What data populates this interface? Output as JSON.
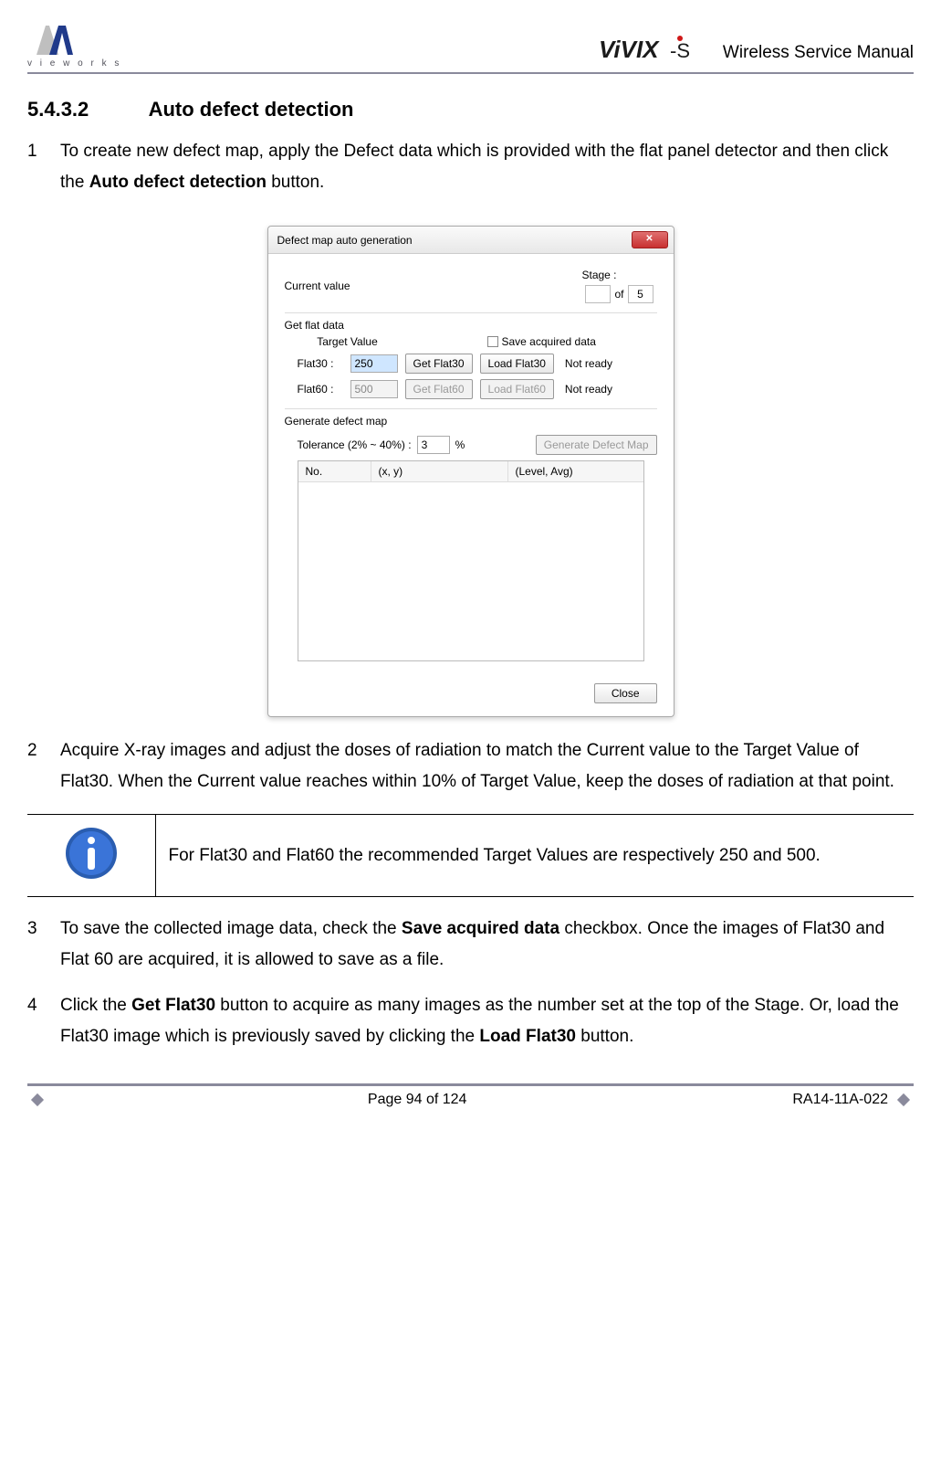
{
  "header": {
    "left_logo_text": "vieworks",
    "right_logo_text": "ViVIX-S",
    "right_label": "Wireless Service Manual"
  },
  "section": {
    "number": "5.4.3.2",
    "title": "Auto defect detection"
  },
  "steps": {
    "s1": {
      "num": "1",
      "text_a": "To create new defect map, apply the Defect data which is provided with the flat panel detector and then click the ",
      "bold_a": "Auto defect detection",
      "text_b": " button."
    },
    "s2": {
      "num": "2",
      "text": "Acquire X-ray images and adjust the doses of radiation to match the Current value to the Target Value of Flat30. When the Current value reaches within 10% of Target Value, keep the doses of radiation at that point."
    },
    "s3": {
      "num": "3",
      "text_a": "To save the collected image data, check the ",
      "bold_a": "Save acquired data",
      "text_b": " checkbox. Once the images of Flat30 and Flat 60 are acquired, it is allowed to save as a file."
    },
    "s4": {
      "num": "4",
      "text_a": "Click the ",
      "bold_a": "Get Flat30",
      "text_b": " button to acquire as many images as the number set at the top of the Stage. Or, load the Flat30 image which is previously saved by clicking the ",
      "bold_b": "Load Flat30",
      "text_c": " button."
    }
  },
  "dialog": {
    "title": "Defect map auto generation",
    "close_glyph": "✕",
    "current_value_label": "Current value",
    "stage_label": "Stage :",
    "stage_of_word": "of",
    "stage_total": "5",
    "get_flat_label": "Get flat data",
    "target_value_label": "Target Value",
    "save_acquired_label": "Save acquired data",
    "flat30_label": "Flat30 :",
    "flat30_value": "250",
    "get_flat30_btn": "Get Flat30",
    "load_flat30_btn": "Load Flat30",
    "flat30_status": "Not ready",
    "flat60_label": "Flat60 :",
    "flat60_value": "500",
    "get_flat60_btn": "Get Flat60",
    "load_flat60_btn": "Load Flat60",
    "flat60_status": "Not ready",
    "generate_label": "Generate defect map",
    "tolerance_label": "Tolerance (2% ~ 40%) :",
    "tolerance_value": "3",
    "tolerance_unit": "%",
    "gdm_btn": "Generate Defect Map",
    "col_no": "No.",
    "col_xy": "(x, y)",
    "col_lvl": "(Level, Avg)",
    "close_btn": "Close"
  },
  "info": {
    "text": "For Flat30 and Flat60 the recommended Target Values are respectively 250 and 500."
  },
  "footer": {
    "page_label": "Page 94 of 124",
    "doc_id": "RA14-11A-022"
  }
}
